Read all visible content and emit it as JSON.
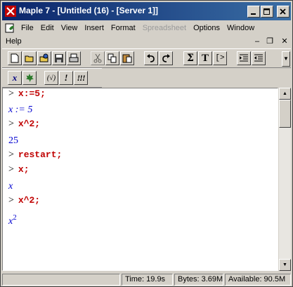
{
  "window": {
    "title": "Maple 7  - [Untitled (16) - [Server 1]]",
    "app_icon": "maple-leaf-icon",
    "caption_buttons": {
      "minimize": "_",
      "maximize": "□",
      "close": "✕"
    }
  },
  "menubar": {
    "items": [
      {
        "label": "File",
        "enabled": true
      },
      {
        "label": "Edit",
        "enabled": true
      },
      {
        "label": "View",
        "enabled": true
      },
      {
        "label": "Insert",
        "enabled": true
      },
      {
        "label": "Format",
        "enabled": true
      },
      {
        "label": "Spreadsheet",
        "enabled": false
      },
      {
        "label": "Options",
        "enabled": true
      },
      {
        "label": "Window",
        "enabled": true
      }
    ],
    "help_label": "Help",
    "mdi_controls": {
      "minimize": "–",
      "restore": "❐",
      "close": "✕"
    }
  },
  "toolbar": {
    "buttons": [
      "new-icon",
      "open-icon",
      "open-url-icon",
      "save-icon",
      "print-icon",
      "cut-icon",
      "copy-icon",
      "paste-icon",
      "undo-icon",
      "redo-icon",
      "sum-icon",
      "text-icon",
      "prompt-icon",
      "indent-icon",
      "outdent-icon"
    ],
    "math_label": "x",
    "text_label": "T",
    "prompt_label": "[>",
    "sum_label": "Σ",
    "eval_labels": {
      "bracket": "(√)",
      "execute": "!",
      "execute_all": "!!!"
    }
  },
  "worksheet": {
    "lines": [
      {
        "kind": "input",
        "prompt": ">",
        "command": "x:=5;"
      },
      {
        "kind": "output",
        "text": "x := 5"
      },
      {
        "kind": "input",
        "prompt": ">",
        "command": "x^2;"
      },
      {
        "kind": "output",
        "text": "25"
      },
      {
        "kind": "input",
        "prompt": ">",
        "command": "restart;"
      },
      {
        "kind": "input",
        "prompt": ">",
        "command": "x;"
      },
      {
        "kind": "output",
        "text": "x"
      },
      {
        "kind": "input",
        "prompt": ">",
        "command": "x^2;"
      },
      {
        "kind": "output",
        "base": "x",
        "exponent": "2"
      }
    ]
  },
  "statusbar": {
    "time": "Time:  19.9s",
    "bytes": "Bytes: 3.69M",
    "available": "Available: 90.5M"
  },
  "colors": {
    "titlebar_start": "#0a246a",
    "titlebar_end": "#3a6ea5",
    "input_command": "#c00000",
    "output_math": "#0000d0"
  }
}
